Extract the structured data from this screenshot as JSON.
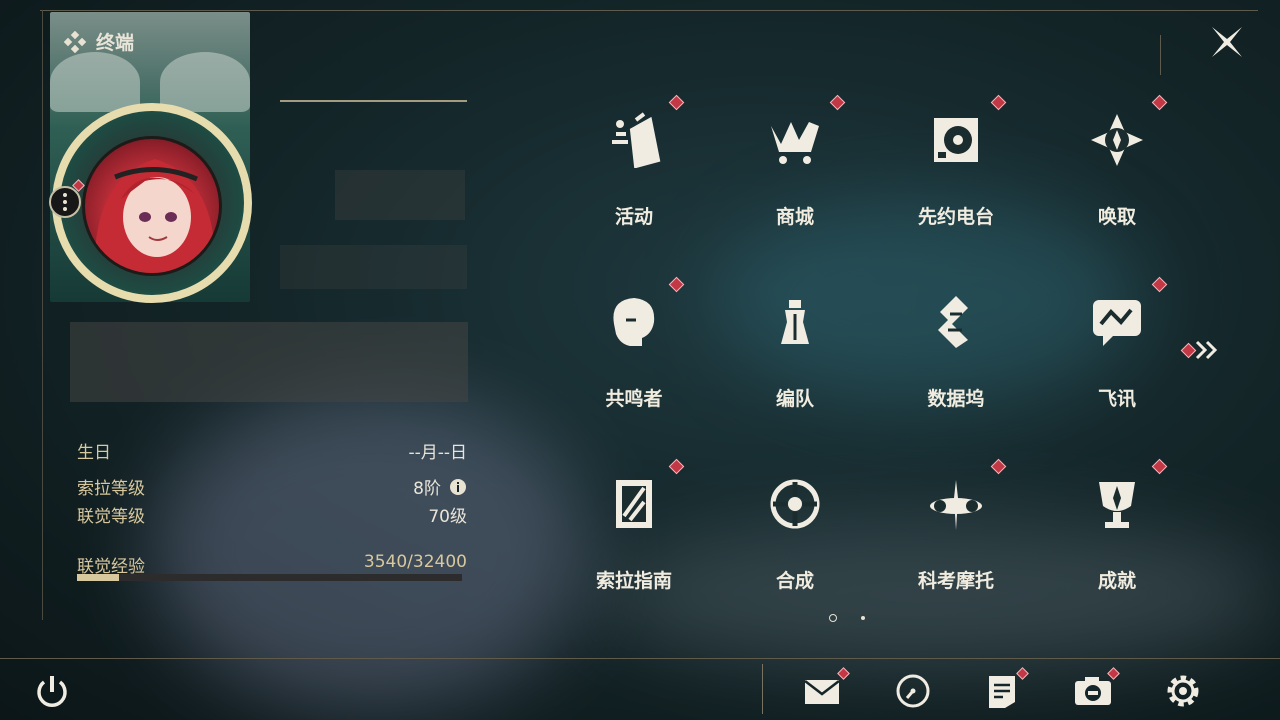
{
  "header": {
    "title": "终端"
  },
  "profile": {
    "birthday_label": "生日",
    "birthday_value": "--月--日",
    "sola_level_label": "索拉等级",
    "sola_level_value": "8阶",
    "union_level_label": "联觉等级",
    "union_level_value": "70级",
    "union_exp_label": "联觉经验",
    "union_exp_value": "3540/32400",
    "union_exp_progress": 0.109
  },
  "menu": {
    "items": [
      {
        "label": "活动",
        "icon": "activity-icon",
        "badge": true
      },
      {
        "label": "商城",
        "icon": "shop-icon",
        "badge": true
      },
      {
        "label": "先约电台",
        "icon": "radio-icon",
        "badge": true
      },
      {
        "label": "唤取",
        "icon": "convene-icon",
        "badge": true
      },
      {
        "label": "共鸣者",
        "icon": "resonator-icon",
        "badge": true
      },
      {
        "label": "编队",
        "icon": "team-icon",
        "badge": false
      },
      {
        "label": "数据坞",
        "icon": "data-bank-icon",
        "badge": false
      },
      {
        "label": "飞讯",
        "icon": "message-icon",
        "badge": true
      },
      {
        "label": "索拉指南",
        "icon": "guidebook-icon",
        "badge": true
      },
      {
        "label": "合成",
        "icon": "synthesis-icon",
        "badge": false
      },
      {
        "label": "科考摩托",
        "icon": "motorcycle-icon",
        "badge": true
      },
      {
        "label": "成就",
        "icon": "achievement-icon",
        "badge": true
      }
    ],
    "page_count": 2,
    "current_page": 1
  },
  "colors": {
    "accent": "#d8c89d",
    "badge": "#c33845",
    "background": "#142629"
  }
}
